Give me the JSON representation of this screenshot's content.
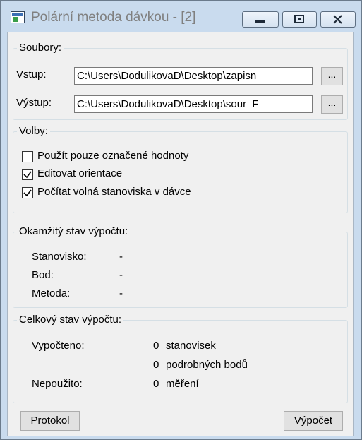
{
  "window": {
    "title": "Polární metoda dávkou - [2]",
    "accent": "#c9dbee"
  },
  "caption_buttons": {
    "minimize_icon": "minimize-icon",
    "maximize_icon": "maximize-icon",
    "close_icon": "close-icon"
  },
  "files": {
    "legend": "Soubory:",
    "input_label": "Vstup:",
    "input_value": "C:\\Users\\DodulikovaD\\Desktop\\zapisn",
    "output_label": "Výstup:",
    "output_value": "C:\\Users\\DodulikovaD\\Desktop\\sour_F",
    "browse_label": "..."
  },
  "options": {
    "legend": "Volby:",
    "items": [
      {
        "label": "Použít pouze označené hodnoty",
        "checked": false
      },
      {
        "label": "Editovat orientace",
        "checked": true
      },
      {
        "label": "Počítat volná stanoviska v dávce",
        "checked": true
      }
    ]
  },
  "current": {
    "legend": "Okamžitý stav výpočtu:",
    "rows": [
      {
        "label": "Stanovisko:",
        "value": "-"
      },
      {
        "label": "Bod:",
        "value": "-"
      },
      {
        "label": "Metoda:",
        "value": "-"
      }
    ]
  },
  "overall": {
    "legend": "Celkový stav výpočtu:",
    "computed_label": "Vypočteno:",
    "computed_stations": "0",
    "stations_unit": "stanovisek",
    "computed_points": "0",
    "points_unit": "podrobných bodů",
    "unused_label": "Nepoužito:",
    "unused_count": "0",
    "unused_unit": "měření"
  },
  "footer": {
    "protocol_label": "Protokol",
    "compute_label": "Výpočet"
  }
}
